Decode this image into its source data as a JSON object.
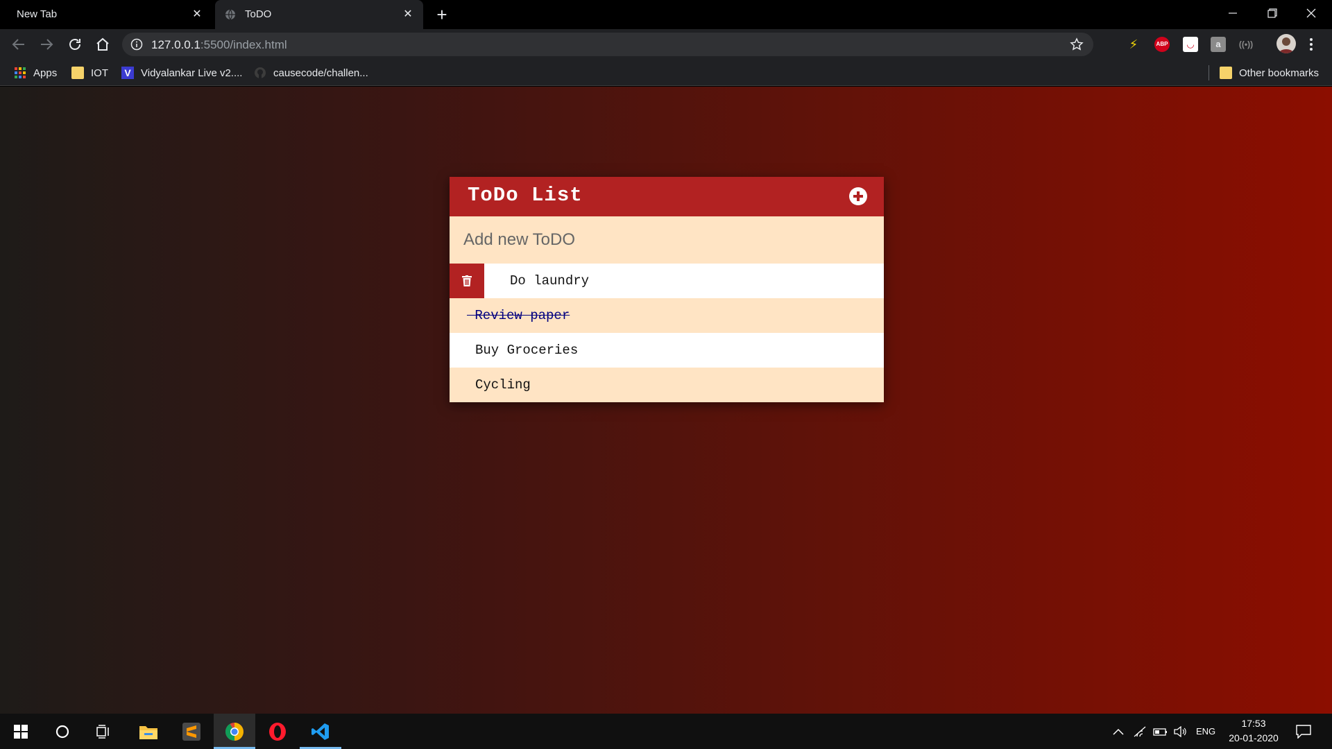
{
  "browser": {
    "tabs": [
      {
        "title": "New Tab",
        "active": false
      },
      {
        "title": "ToDO",
        "active": true
      }
    ],
    "address": {
      "host": "127.0.0.1",
      "rest": ":5500/index.html"
    },
    "extensions": [
      "bolt-extension-icon",
      "adblock-plus-icon",
      "pocket-icon",
      "amazon-icon",
      "broadcast-icon"
    ],
    "bookmarks": [
      {
        "label": "Apps",
        "icon": "apps-grid-icon"
      },
      {
        "label": "IOT",
        "icon": "folder-icon"
      },
      {
        "label": "Vidyalankar Live v2....",
        "icon": "vidyalankar-icon"
      },
      {
        "label": "causecode/challen...",
        "icon": "github-icon"
      }
    ],
    "other_bookmarks": "Other bookmarks"
  },
  "app": {
    "title": "ToDo List",
    "input_placeholder": "Add new ToDO",
    "accent_color": "#b22222",
    "alt_row_color": "#ffe4c4",
    "todos": [
      {
        "text": "Do laundry",
        "done": false,
        "hovered": true
      },
      {
        "text": "Review paper",
        "done": true,
        "hovered": false
      },
      {
        "text": "Buy Groceries",
        "done": false,
        "hovered": false
      },
      {
        "text": "Cycling",
        "done": false,
        "hovered": false
      }
    ]
  },
  "taskbar": {
    "apps": [
      "windows-start-icon",
      "cortana-icon",
      "task-view-icon",
      "file-explorer-icon",
      "sublime-text-icon",
      "chrome-icon",
      "opera-icon",
      "vscode-icon"
    ],
    "language": "ENG",
    "time": "17:53",
    "date": "20-01-2020"
  }
}
